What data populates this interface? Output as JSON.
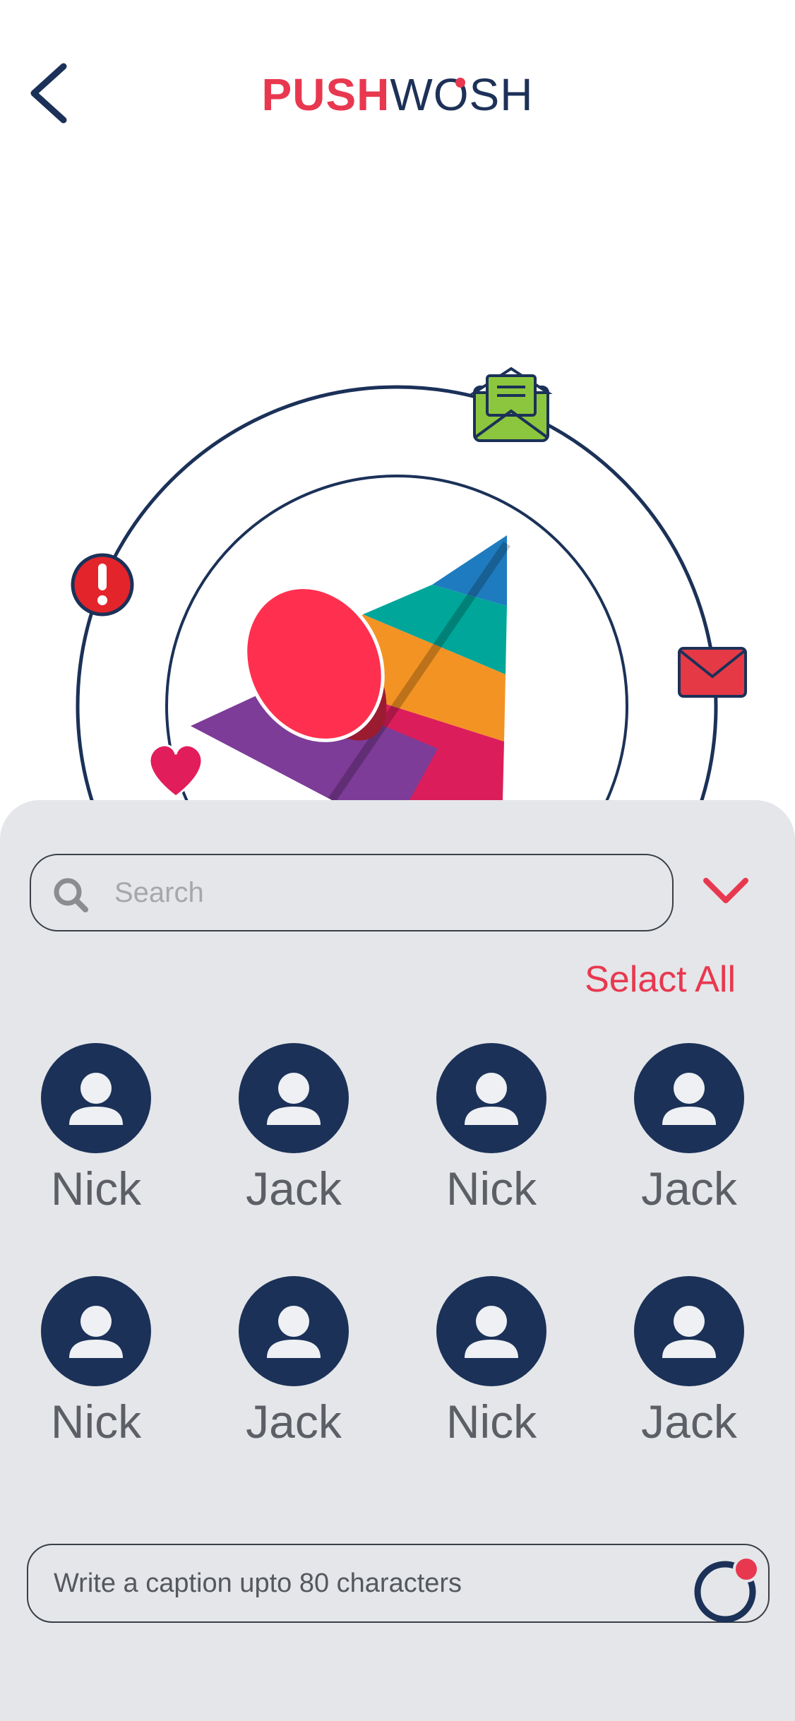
{
  "header": {
    "logo_part1": "PUSH",
    "logo_part2_pre": "W",
    "logo_part2_o": "O",
    "logo_part2_post": "SH",
    "back_icon": "chevron-left-icon"
  },
  "colors": {
    "accent": "#e8384f",
    "navy": "#1b3158",
    "sheet_bg": "#e4e6e9"
  },
  "search": {
    "placeholder": "Search",
    "value": ""
  },
  "select_all_label": "Selact All",
  "contacts": [
    {
      "name": "Nick"
    },
    {
      "name": "Jack"
    },
    {
      "name": "Nick"
    },
    {
      "name": "Jack"
    },
    {
      "name": "Nick"
    },
    {
      "name": "Jack"
    },
    {
      "name": "Nick"
    },
    {
      "name": "Jack"
    }
  ],
  "caption": {
    "placeholder": "Write a caption upto 80 characters",
    "value": ""
  }
}
